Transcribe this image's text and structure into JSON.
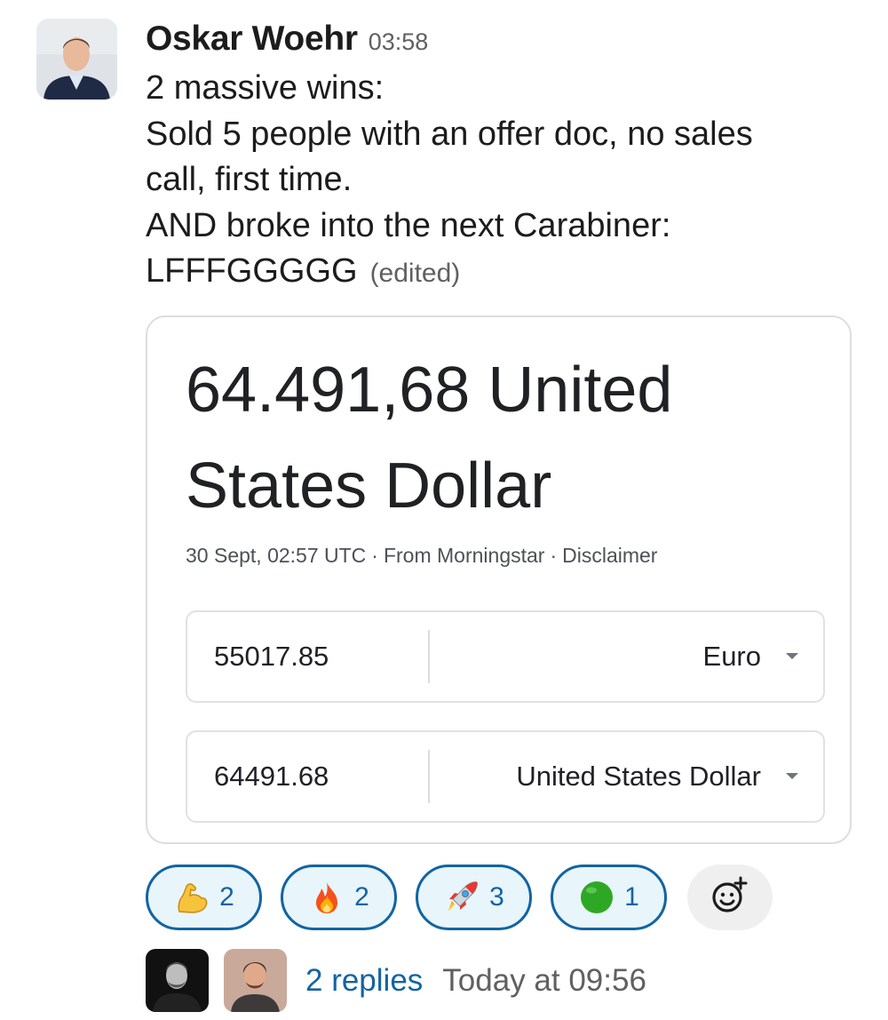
{
  "message": {
    "sender": "Oskar Woehr",
    "time": "03:58",
    "lines": [
      "2 massive wins:",
      "Sold 5 people with an offer doc, no sales",
      "call, first time.",
      "AND broke into the next Carabiner:",
      "LFFFGGGGG"
    ],
    "edited_label": "(edited)"
  },
  "attachment": {
    "result_line1": "64.491,68 United",
    "result_line2": "States Dollar",
    "timestamp": "30 Sept, 02:57 UTC",
    "source": "From Morningstar",
    "disclaimer": "Disclaimer",
    "separator": "·",
    "from_amount": "55017.85",
    "from_currency": "Euro",
    "to_amount": "64491.68",
    "to_currency": "United States Dollar"
  },
  "reactions": [
    {
      "emoji": "flexed-biceps",
      "count": "2"
    },
    {
      "emoji": "fire",
      "count": "2"
    },
    {
      "emoji": "rocket",
      "count": "3"
    },
    {
      "emoji": "green-circle",
      "count": "1"
    }
  ],
  "thread": {
    "replies": "2 replies",
    "last_reply": "Today at 09:56"
  },
  "colors": {
    "link_blue": "#1264a3",
    "reaction_bg": "#e8f5fa",
    "muted_text": "#616061"
  }
}
